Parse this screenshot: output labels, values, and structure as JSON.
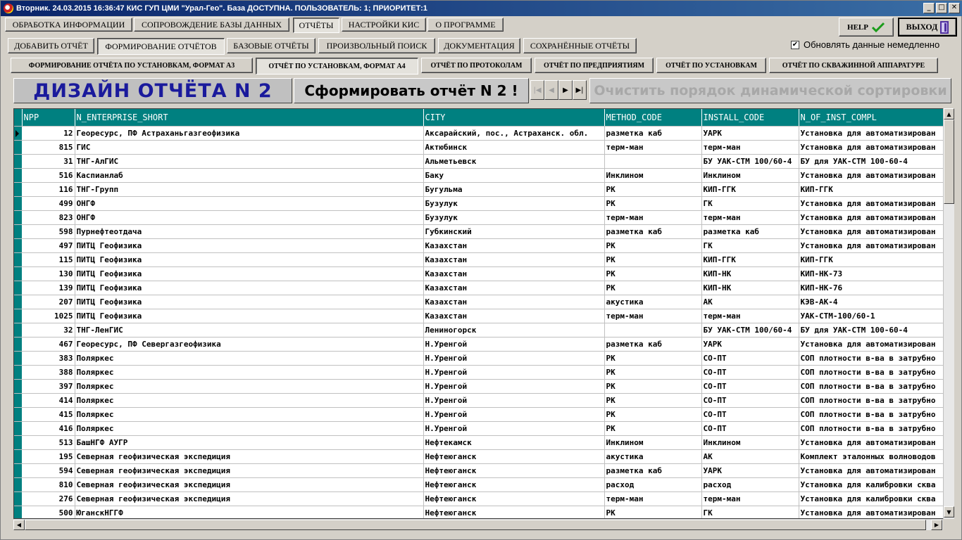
{
  "window": {
    "title": "Вторник. 24.03.2015 16:36:47 КИС ГУП ЦМИ \"Урал-Гео\". База ДОСТУПНА. ПОЛЬЗОВАТЕЛЬ: 1; ПРИОРИТЕТ:1",
    "minimize": "_",
    "maximize": "□",
    "close": "✕"
  },
  "main_tabs": [
    "ОБРАБОТКА ИНФОРМАЦИИ",
    "СОПРОВОЖДЕНИЕ БАЗЫ ДАННЫХ",
    "ОТЧЁТЫ",
    "НАСТРОЙКИ КИС",
    "О ПРОГРАММЕ"
  ],
  "sub_tabs": [
    "ДОБАВИТЬ ОТЧЁТ",
    "ФОРМИРОВАНИЕ ОТЧЁТОВ",
    "БАЗОВЫЕ ОТЧЁТЫ",
    "ПРОИЗВОЛЬНЫЙ ПОИСК",
    "ДОКУМЕНТАЦИЯ",
    "СОХРАНЁННЫЕ ОТЧЁТЫ"
  ],
  "report_tabs": [
    "ФОРМИРОВАНИЕ ОТЧЁТА ПО УСТАНОВКАМ, ФОРМАТ А3",
    "ОТЧЁТ ПО УСТАНОВКАМ, ФОРМАТ А4",
    "ОТЧЁТ ПО ПРОТОКОЛАМ",
    "ОТЧЁТ ПО ПРЕДПРИЯТИЯМ",
    "ОТЧЁТ ПО УСТАНОВКАМ",
    "ОТЧЁТ ПО СКВАЖИННОЙ АППАРАТУРЕ"
  ],
  "help": {
    "label": "HELP",
    "icon": "checkmark-icon",
    "icon_color": "#1a9c1a"
  },
  "exit": {
    "label": "ВЫХОД"
  },
  "auto_update": {
    "label": "Обновлять данные немедленно",
    "checked": "✔"
  },
  "design_title": "ДИЗАЙН ОТЧЁТА N 2",
  "form_button": "Сформировать отчёт N 2 !",
  "nav": {
    "first": "|◀",
    "prev": "◀",
    "next": "▶",
    "last": "▶|"
  },
  "clear_button": "Очистить порядок динамической сортировки",
  "grid": {
    "columns": [
      "NPP",
      "N_ENTERPRISE_SHORT",
      "CITY",
      "METHOD_CODE",
      "INSTALL_CODE",
      "N_OF_INST_COMPL"
    ],
    "rows": [
      [
        "12",
        "Георесурс, ПФ Астраханьгазгеофизика",
        "Аксарайский, пос., Астраханск. обл.",
        "разметка каб",
        "УАРК",
        "Установка для автоматизирован"
      ],
      [
        "815",
        "ГИС",
        "Актюбинск",
        "терм-ман",
        "терм-ман",
        "Установка для автоматизирован"
      ],
      [
        "31",
        "ТНГ-АлГИС",
        "Альметьевск",
        "",
        "БУ УАК-СТМ 100/60-4",
        "БУ для УАК-СТМ 100-60-4"
      ],
      [
        "516",
        "Каспианлаб",
        "Баку",
        "Инклином",
        "Инклином",
        "Установка для автоматизирован"
      ],
      [
        "116",
        "ТНГ-Групп",
        "Бугульма",
        "РК",
        "КИП-ГГК",
        "КИП-ГГК"
      ],
      [
        "499",
        "ОНГФ",
        "Бузулук",
        "РК",
        "ГК",
        "Установка для автоматизирован"
      ],
      [
        "823",
        "ОНГФ",
        "Бузулук",
        "терм-ман",
        "терм-ман",
        "Установка для автоматизирован"
      ],
      [
        "598",
        "Пурнефтеотдача",
        "Губкинский",
        "разметка каб",
        "разметка каб",
        "Установка для автоматизирован"
      ],
      [
        "497",
        "ПИТЦ Геофизика",
        "Казахстан",
        "РК",
        "ГК",
        "Установка для автоматизирован"
      ],
      [
        "115",
        "ПИТЦ Геофизика",
        "Казахстан",
        "РК",
        "КИП-ГГК",
        "КИП-ГГК"
      ],
      [
        "130",
        "ПИТЦ Геофизика",
        "Казахстан",
        "РК",
        "КИП-НК",
        "КИП-НК-73"
      ],
      [
        "139",
        "ПИТЦ Геофизика",
        "Казахстан",
        "РК",
        "КИП-НК",
        "КИП-НК-76"
      ],
      [
        "207",
        "ПИТЦ Геофизика",
        "Казахстан",
        "акустика",
        "АК",
        "КЭВ-АК-4"
      ],
      [
        "1025",
        "ПИТЦ Геофизика",
        "Казахстан",
        "терм-ман",
        "терм-ман",
        "УАК-СТМ-100/60-1"
      ],
      [
        "32",
        "ТНГ-ЛенГИС",
        "Лениногорск",
        "",
        "БУ УАК-СТМ 100/60-4",
        "БУ для УАК-СТМ 100-60-4"
      ],
      [
        "467",
        "Георесурс, ПФ Севергазгеофизика",
        "Н.Уренгой",
        "разметка каб",
        "УАРК",
        "Установка для автоматизирован"
      ],
      [
        "383",
        "Поляркес",
        "Н.Уренгой",
        "РК",
        "СО-ПТ",
        "СОП плотности в-ва в затрубно"
      ],
      [
        "388",
        "Поляркес",
        "Н.Уренгой",
        "РК",
        "СО-ПТ",
        "СОП плотности в-ва в затрубно"
      ],
      [
        "397",
        "Поляркес",
        "Н.Уренгой",
        "РК",
        "СО-ПТ",
        "СОП плотности в-ва в затрубно"
      ],
      [
        "414",
        "Поляркес",
        "Н.Уренгой",
        "РК",
        "СО-ПТ",
        "СОП плотности в-ва в затрубно"
      ],
      [
        "415",
        "Поляркес",
        "Н.Уренгой",
        "РК",
        "СО-ПТ",
        "СОП плотности в-ва в затрубно"
      ],
      [
        "416",
        "Поляркес",
        "Н.Уренгой",
        "РК",
        "СО-ПТ",
        "СОП плотности в-ва в затрубно"
      ],
      [
        "513",
        "БашНГФ АУГР",
        "Нефтекамск",
        "Инклином",
        "Инклином",
        "Установка для автоматизирован"
      ],
      [
        "195",
        "Северная геофизическая экспедиция",
        "Нефтеюганск",
        "акустика",
        "АК",
        "Комплект эталонных волноводов"
      ],
      [
        "594",
        "Северная геофизическая экспедиция",
        "Нефтеюганск",
        "разметка каб",
        "УАРК",
        "Установка для автоматизирован"
      ],
      [
        "810",
        "Северная геофизическая экспедиция",
        "Нефтеюганск",
        "расход",
        "расход",
        "Установка для калибровки сква"
      ],
      [
        "276",
        "Северная геофизическая экспедиция",
        "Нефтеюганск",
        "терм-ман",
        "терм-ман",
        "Установка для калибровки сква"
      ],
      [
        "500",
        "ЮганскНГГФ",
        "Нефтеюганск",
        "РК",
        "ГК",
        "Установка для автоматизирован"
      ]
    ]
  },
  "scroll": {
    "up": "▲",
    "down": "▼",
    "left": "◀",
    "right": "▶"
  }
}
